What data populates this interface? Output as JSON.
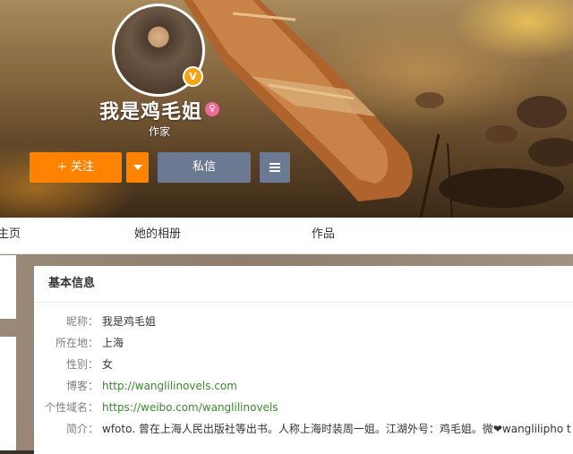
{
  "profile": {
    "name": "我是鸡毛姐",
    "title": "作家",
    "verified_badge": "V",
    "gender_icon": "♀"
  },
  "actions": {
    "follow": "+ 关注",
    "message": "私信"
  },
  "tabs": [
    "主页",
    "她的相册",
    "作品"
  ],
  "info": {
    "heading": "基本信息",
    "rows": [
      {
        "label": "昵称：",
        "value": "我是鸡毛姐"
      },
      {
        "label": "所在地：",
        "value": "上海"
      },
      {
        "label": "性别：",
        "value": "女"
      },
      {
        "label": "博客：",
        "value": "http://wanglilinovels.com"
      },
      {
        "label": "个性域名：",
        "value": "https://weibo.com/wanglilinovels"
      },
      {
        "label": "简介：",
        "value": "wfoto. 曾在上海人民出版社等出书。人称上海时装周一姐。江湖外号：鸡毛姐。微❤wanglilipho t"
      }
    ]
  },
  "colors": {
    "accent": "#ff8200",
    "secondary_button": "#6b7a92",
    "link": "#3a8a2e"
  }
}
